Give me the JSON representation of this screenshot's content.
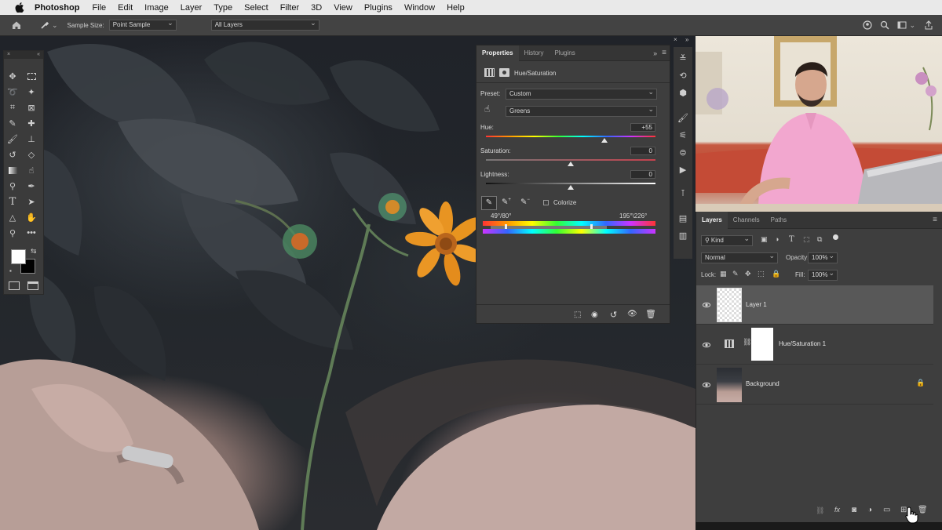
{
  "menubar": {
    "app_name": "Photoshop",
    "items": [
      "File",
      "Edit",
      "Image",
      "Layer",
      "Type",
      "Select",
      "Filter",
      "3D",
      "View",
      "Plugins",
      "Window",
      "Help"
    ]
  },
  "options_bar": {
    "sample_size_label": "Sample Size:",
    "sample_size_value": "Point Sample",
    "sample_layers_value": "All Layers"
  },
  "properties": {
    "tabs": [
      "Properties",
      "History",
      "Plugins"
    ],
    "active_tab": "Properties",
    "adjustment_title": "Hue/Saturation",
    "preset_label": "Preset:",
    "preset_value": "Custom",
    "channel_value": "Greens",
    "hue_label": "Hue:",
    "hue_value": "+55",
    "hue_fraction": 0.7,
    "saturation_label": "Saturation:",
    "saturation_value": "0",
    "saturation_fraction": 0.5,
    "lightness_label": "Lightness:",
    "lightness_value": "0",
    "lightness_fraction": 0.5,
    "colorize_label": "Colorize",
    "range_left": "49°/80°",
    "range_right": "195°\\226°"
  },
  "layers_panel": {
    "tabs": [
      "Layers",
      "Channels",
      "Paths"
    ],
    "active_tab": "Layers",
    "filter_kind": "Kind",
    "blend_mode": "Normal",
    "opacity_label": "Opacity:",
    "opacity_value": "100%",
    "lock_label": "Lock:",
    "fill_label": "Fill:",
    "fill_value": "100%",
    "layers": [
      {
        "name": "Layer 1",
        "selected": true
      },
      {
        "name": "Hue/Saturation 1",
        "selected": false
      },
      {
        "name": "Background",
        "selected": false,
        "locked": true
      }
    ]
  },
  "colors": {
    "panel_bg": "#3e3e3e",
    "selected_layer": "#585858",
    "accent_orange": "#e89422"
  }
}
